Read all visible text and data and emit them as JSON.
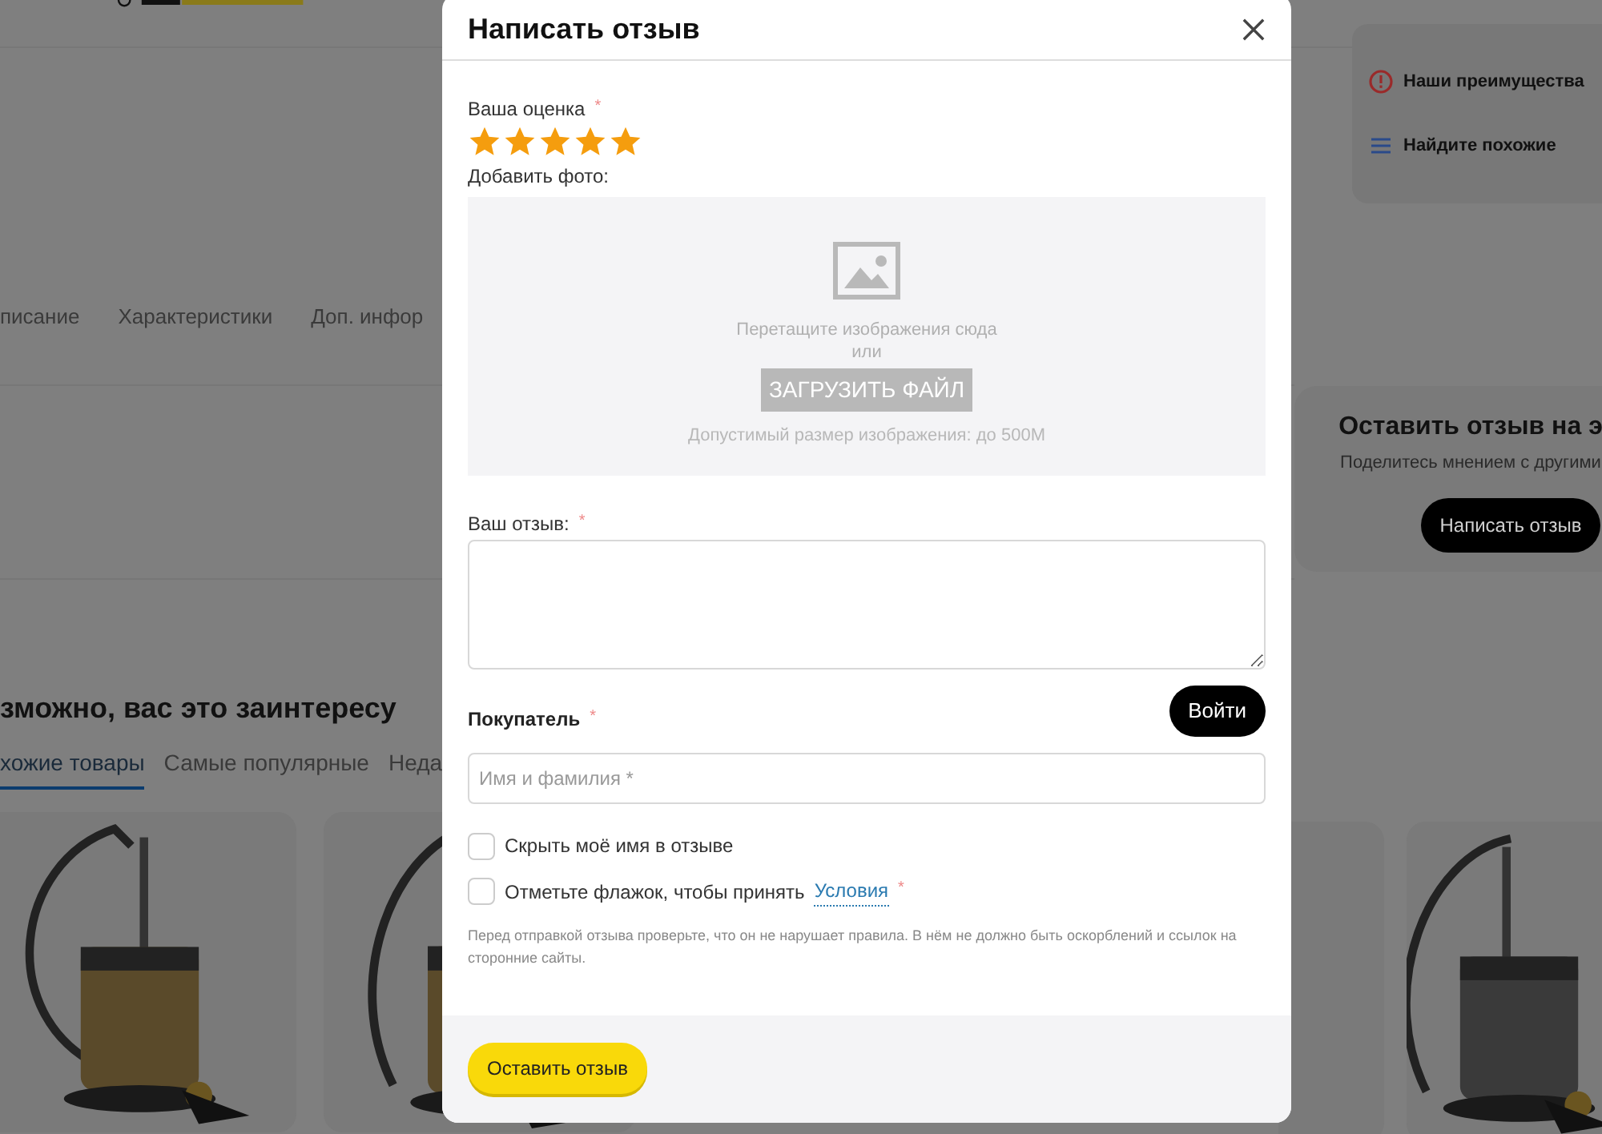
{
  "page": {
    "advantages": [
      {
        "kind": "alert",
        "label": "Наши преимущества"
      },
      {
        "kind": "list",
        "label": "Найдите похожие"
      }
    ],
    "tabs": [
      {
        "label": "писание",
        "selected": false
      },
      {
        "label": "Характеристики",
        "selected": false
      },
      {
        "label": "Доп. инфор",
        "selected": false
      }
    ],
    "review_card": {
      "title": "Оставить отзыв на э",
      "subtitle": "Поделитесь мнением с другими",
      "button": "Написать отзыв"
    },
    "section_title": "зможно, вас это заинтересу",
    "section_tabs": [
      {
        "label": "хожие товары",
        "selected": true
      },
      {
        "label": "Самые популярные",
        "selected": false
      },
      {
        "label": "Неда",
        "selected": false
      }
    ]
  },
  "modal": {
    "title": "Написать отзыв",
    "rating": {
      "label": "Ваша оценка",
      "required": "*",
      "stars": 5
    },
    "photo": {
      "label": "Добавить фото:",
      "hint": "Перетащите изображения сюда",
      "or": "или",
      "button": "ЗАГРУЗИТЬ ФАЙЛ",
      "note": "Допустимый размер изображения: до 500M"
    },
    "review": {
      "label": "Ваш отзыв:",
      "required": "*"
    },
    "login_button": "Войти",
    "buyer": {
      "label": "Покупатель",
      "required": "*",
      "placeholder": "Имя и фамилия *"
    },
    "checkboxes": [
      {
        "label": "Скрыть моё имя в отзыве",
        "checked": false
      },
      {
        "label": "Отметьте флажок, чтобы принять",
        "link": "Условия",
        "required": "*",
        "checked": false
      }
    ],
    "notice": "Перед отправкой отзыва проверьте, что он не нарушает правила. В нём не должно быть оскорблений и ссылок на сторонние сайты.",
    "submit": "Оставить отзыв"
  }
}
